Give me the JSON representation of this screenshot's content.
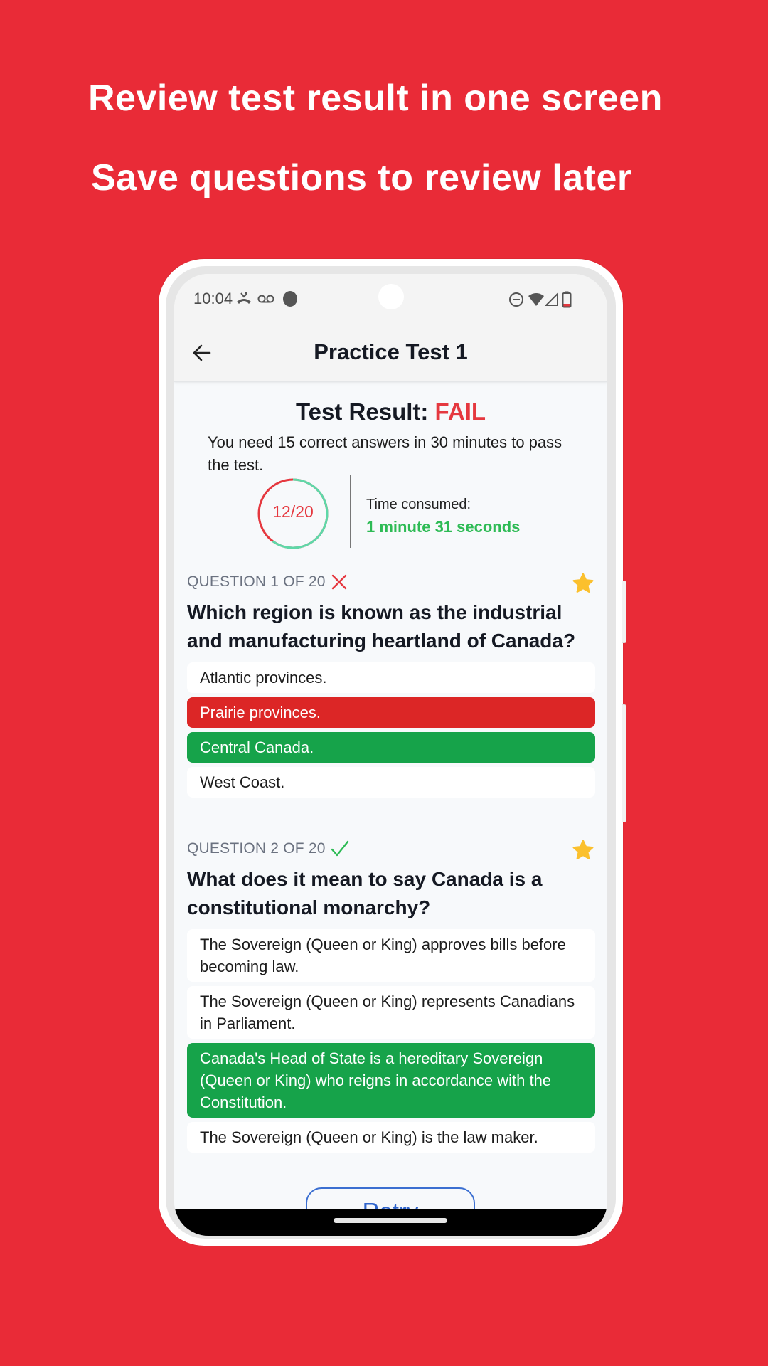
{
  "promo": {
    "headline_1": "Review test result in one screen",
    "headline_2": "Save questions to review later",
    "background_color": "#E92B37"
  },
  "status_bar": {
    "time": "10:04",
    "left_icons": [
      "missed-call-icon",
      "voicemail-icon",
      "notification-dot-icon"
    ],
    "right_icons": [
      "do-not-disturb-icon",
      "wifi-icon",
      "cellular-signal-icon",
      "battery-low-icon"
    ]
  },
  "app_bar": {
    "back_icon": "arrow-left-icon",
    "title": "Practice Test 1"
  },
  "result": {
    "title_prefix": "Test Result: ",
    "status": "FAIL",
    "status_color": "#E5383F",
    "description": "You need 15 correct answers in 30 minutes to pass the test.",
    "score_text": "12/20",
    "correct": 12,
    "total": 20,
    "correct_fraction": 0.6,
    "ring_correct_color": "#5ED8A8",
    "ring_incorrect_color": "#E5383F",
    "time_label": "Time consumed:",
    "time_value": "1 minute 31 seconds",
    "time_value_color": "#2EBB55"
  },
  "questions": [
    {
      "label": "QUESTION 1 OF 20",
      "result_icon": "cross-icon",
      "is_correct": false,
      "starred": true,
      "text": "Which region is known as the industrial and manufacturing heartland of Canada?",
      "options": [
        {
          "text": "Atlantic provinces.",
          "state": "neutral"
        },
        {
          "text": "Prairie provinces.",
          "state": "wrong"
        },
        {
          "text": "Central Canada.",
          "state": "correct"
        },
        {
          "text": "West Coast.",
          "state": "neutral"
        }
      ]
    },
    {
      "label": "QUESTION 2 OF 20",
      "result_icon": "check-icon",
      "is_correct": true,
      "starred": true,
      "text": "What does it mean to say Canada is a constitutional monarchy?",
      "options": [
        {
          "text": "The Sovereign (Queen or King) approves bills before becoming law.",
          "state": "neutral"
        },
        {
          "text": "The Sovereign (Queen or King) represents Canadians in Parliament.",
          "state": "neutral"
        },
        {
          "text": "Canada's Head of State is a hereditary Sovereign (Queen or King) who reigns in accordance with the Constitution.",
          "state": "correct"
        },
        {
          "text": "The Sovereign (Queen or King) is the law maker.",
          "state": "neutral"
        }
      ]
    }
  ],
  "colors": {
    "wrong": "#DC2626",
    "correct": "#16A34A",
    "star": "#FBC02D",
    "cross": "#E5383F",
    "check": "#2EBB55",
    "accent_blue": "#2F64CC"
  },
  "footer": {
    "retry_label": "Retry"
  }
}
